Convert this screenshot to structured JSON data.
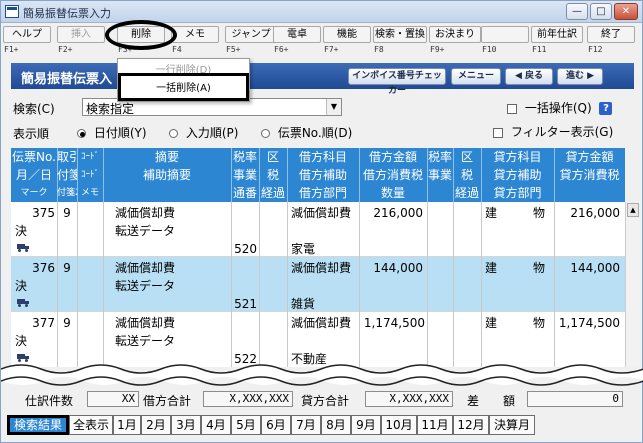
{
  "window": {
    "title": "簡易振替伝票入力",
    "controls": [
      "minimize",
      "maximize",
      "close"
    ]
  },
  "fkeys": [
    {
      "label": "ヘルプ",
      "key": "F1+",
      "disabled": false
    },
    {
      "label": "挿入",
      "key": "F2+",
      "disabled": true
    },
    {
      "label": "削除",
      "key": "F3+",
      "disabled": false
    },
    {
      "label": "メモ",
      "key": "F4",
      "disabled": false
    },
    {
      "label": "ジャンプ",
      "key": "F5+",
      "disabled": false
    },
    {
      "label": "電卓",
      "key": "F6+",
      "disabled": false
    },
    {
      "label": "機能",
      "key": "F7+",
      "disabled": false
    },
    {
      "label": "検索・置換",
      "key": "F8",
      "disabled": false
    },
    {
      "label": "お決まり",
      "key": "F9+",
      "disabled": false
    },
    {
      "label": "",
      "key": "F10",
      "disabled": false
    },
    {
      "label": "前年仕訳",
      "key": "F11",
      "disabled": false
    },
    {
      "label": "終了",
      "key": "F12",
      "disabled": false
    }
  ],
  "delete_menu": {
    "items": [
      {
        "label": "一行削除(D)",
        "disabled": true
      },
      {
        "label": "一括削除(A)",
        "disabled": false
      }
    ]
  },
  "banner": {
    "title": "簡易振替伝票入",
    "invoice_btn": "インボイス番号チェッカー",
    "menu_btn": "メニュー",
    "back_btn": "◀ 戻る",
    "next_btn": "進む ▶"
  },
  "search": {
    "label": "検索(C)",
    "value": "検索指定",
    "bulk_label": "一括操作(Q)",
    "help": "?"
  },
  "order": {
    "label": "表示順",
    "options": [
      "日付順(Y)",
      "入力順(P)",
      "伝票No.順(D)"
    ],
    "selected": 0,
    "filter_label": "フィルター表示(G)"
  },
  "table": {
    "header_row1": [
      "伝票No.",
      "取引",
      "ｺｰﾄﾞ",
      "摘要",
      "税率",
      "区",
      "借方科目",
      "借方金額",
      "税率",
      "区",
      "貸方科目",
      "貸方金額"
    ],
    "header_row2": [
      "月／日",
      "付箋1",
      "ｺｰﾄﾞ",
      "補助摘要",
      "事業",
      "税",
      "借方補助",
      "借方消費税",
      "事業",
      "税",
      "貸方補助",
      "貸方消費税"
    ],
    "header_row3": [
      "マーク",
      "付箋2",
      "メモ",
      "",
      "通番",
      "経過",
      "借方部門",
      "数量",
      "",
      "経過",
      "貸方部門",
      ""
    ],
    "rows": [
      {
        "no": "375",
        "torihiki": "9",
        "tekiyo": "減価償却費",
        "hojo_tekiyo": "転送データ",
        "mark": "決",
        "tsuban": "520",
        "kari_kamoku": "減価償却費",
        "kari_kingaku": "216,000",
        "kari_bumon": "家電",
        "kashi_kamoku": "建　　　物",
        "kashi_kingaku": "216,000",
        "selected": false
      },
      {
        "no": "376",
        "torihiki": "9",
        "tekiyo": "減価償却費",
        "hojo_tekiyo": "転送データ",
        "mark": "決",
        "tsuban": "521",
        "kari_kamoku": "減価償却費",
        "kari_kingaku": "144,000",
        "kari_bumon": "雑貨",
        "kashi_kamoku": "建　　　物",
        "kashi_kingaku": "144,000",
        "selected": true
      },
      {
        "no": "377",
        "torihiki": "9",
        "tekiyo": "減価償却費",
        "hojo_tekiyo": "転送データ",
        "mark": "決",
        "tsuban": "522",
        "kari_kamoku": "減価償却費",
        "kari_kingaku": "1,174,500",
        "kari_bumon": "不動産",
        "kashi_kamoku": "建　　　物",
        "kashi_kingaku": "1,174,500",
        "selected": false
      }
    ]
  },
  "footer": {
    "count_label": "仕訳件数",
    "count_value": "XX",
    "kari_label": "借方合計",
    "kari_value": "X,XXX,XXX",
    "kashi_label": "貸方合計",
    "kashi_value": "X,XXX,XXX",
    "sagaku_label": "差　　額",
    "sagaku_value": "0"
  },
  "tabs": [
    "検索結果",
    "全表示",
    "1月",
    "2月",
    "3月",
    "4月",
    "5月",
    "6月",
    "7月",
    "8月",
    "9月",
    "10月",
    "11月",
    "12月",
    "決算月"
  ],
  "colors": {
    "banner": "#1f4a94",
    "header": "#2d86d2",
    "selected_row": "#b9dff5"
  }
}
